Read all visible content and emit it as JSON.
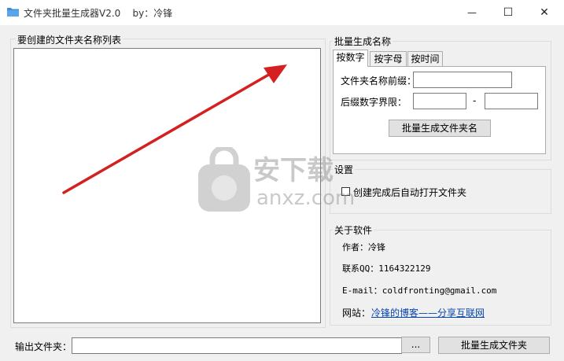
{
  "window": {
    "title": "文件夹批量生成器V2.0    by：冷锋",
    "minimize": "—",
    "maximize": "☐",
    "close": "✕"
  },
  "list_panel": {
    "title": "要创建的文件夹名称列表"
  },
  "batch_panel": {
    "title": "批量生成名称",
    "tabs": [
      "按数字",
      "按字母",
      "按时间"
    ],
    "prefix_label": "文件夹名称前缀：",
    "prefix_value": "",
    "range_label": "后缀数字界限：",
    "range_from": "",
    "range_separator": "-",
    "range_to": "",
    "generate_button": "批量生成文件夹名"
  },
  "settings_panel": {
    "title": "设置",
    "auto_open_label": "创建完成后自动打开文件夹",
    "auto_open_checked": false
  },
  "about_panel": {
    "title": "关于软件",
    "author": "作者：冷锋",
    "qq": "联系QQ：1164322129",
    "email": "E-mail：coldfronting@gmail.com",
    "website_label": "网站：",
    "website_link": "冷锋的博客——分享互联网"
  },
  "footer": {
    "output_label": "输出文件夹：",
    "output_value": "",
    "browse_button": "...",
    "create_button": "批量生成文件夹"
  },
  "watermark": {
    "text": "安下载",
    "url": "anxz.com"
  },
  "colors": {
    "arrow": "#d42020",
    "link": "#0645ad",
    "folder_icon": "#3c8fd6"
  }
}
